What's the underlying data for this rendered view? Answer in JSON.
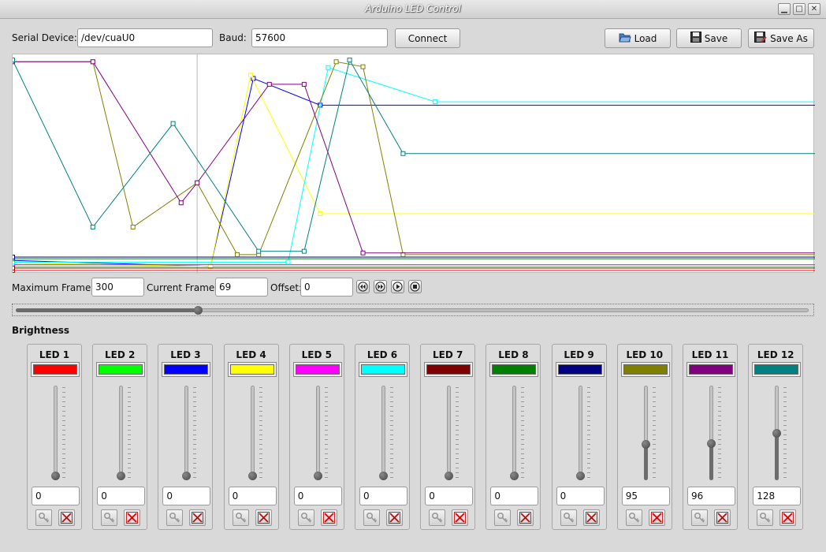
{
  "window": {
    "title": "Arduino LED Control"
  },
  "connection": {
    "serial_label": "Serial Device:",
    "serial_value": "/dev/cuaU0",
    "baud_label": "Baud:",
    "baud_value": "57600",
    "connect_label": "Connect"
  },
  "file": {
    "load_label": "Load",
    "save_label": "Save",
    "save_as_label": "Save As"
  },
  "frames": {
    "max_label": "Maximum Frame:",
    "max_value": "300",
    "current_label": "Current Frame:",
    "current_value": "69",
    "offset_label": "Offset:",
    "offset_value": "0",
    "position_fraction": 0.23
  },
  "brightness": {
    "title": "Brightness",
    "max": 255,
    "leds": [
      {
        "name": "LED 1",
        "value": "0",
        "color": "#ff0000"
      },
      {
        "name": "LED 2",
        "value": "0",
        "color": "#00ff00"
      },
      {
        "name": "LED 3",
        "value": "0",
        "color": "#0000ff"
      },
      {
        "name": "LED 4",
        "value": "0",
        "color": "#ffff00"
      },
      {
        "name": "LED 5",
        "value": "0",
        "color": "#ff00ff"
      },
      {
        "name": "LED 6",
        "value": "0",
        "color": "#00ffff"
      },
      {
        "name": "LED 7",
        "value": "0",
        "color": "#800000"
      },
      {
        "name": "LED 8",
        "value": "0",
        "color": "#008000"
      },
      {
        "name": "LED 9",
        "value": "0",
        "color": "#000080"
      },
      {
        "name": "LED 10",
        "value": "95",
        "color": "#808000"
      },
      {
        "name": "LED 11",
        "value": "96",
        "color": "#800080"
      },
      {
        "name": "LED 12",
        "value": "128",
        "color": "#008080"
      }
    ]
  },
  "chart_data": {
    "type": "line",
    "xlim": [
      0,
      300
    ],
    "ylim": [
      0,
      255
    ],
    "current_frame": 69,
    "series": [
      {
        "led": "LED 1",
        "color": "#ff0000",
        "points": [
          [
            0,
            0
          ],
          [
            300,
            0
          ]
        ]
      },
      {
        "led": "LED 2",
        "color": "#00ff00",
        "points": [
          [
            0,
            5
          ],
          [
            300,
            5
          ]
        ]
      },
      {
        "led": "LED 3",
        "color": "#0000ff",
        "points": [
          [
            0,
            12
          ],
          [
            74,
            5
          ],
          [
            90,
            230
          ],
          [
            115,
            198
          ],
          [
            300,
            198
          ]
        ]
      },
      {
        "led": "LED 4",
        "color": "#ffff00",
        "points": [
          [
            0,
            9
          ],
          [
            74,
            5
          ],
          [
            89,
            234
          ],
          [
            115,
            68
          ],
          [
            300,
            68
          ]
        ]
      },
      {
        "led": "LED 5",
        "color": "#ff00ff",
        "points": [
          [
            0,
            7
          ],
          [
            300,
            7
          ]
        ]
      },
      {
        "led": "LED 6",
        "color": "#00ffff",
        "points": [
          [
            0,
            10
          ],
          [
            103,
            10
          ],
          [
            118,
            243
          ],
          [
            158,
            202
          ],
          [
            300,
            202
          ]
        ]
      },
      {
        "led": "LED 7",
        "color": "#800000",
        "points": [
          [
            0,
            3
          ],
          [
            300,
            3
          ]
        ]
      },
      {
        "led": "LED 8",
        "color": "#008000",
        "points": [
          [
            0,
            14
          ],
          [
            300,
            14
          ]
        ]
      },
      {
        "led": "LED 9",
        "color": "#000080",
        "points": [
          [
            0,
            16
          ],
          [
            300,
            16
          ]
        ]
      },
      {
        "led": "LED 10",
        "color": "#808000",
        "points": [
          [
            0,
            250
          ],
          [
            30,
            250
          ],
          [
            45,
            52
          ],
          [
            69,
            105
          ],
          [
            84,
            19
          ],
          [
            92,
            19
          ],
          [
            121,
            250
          ],
          [
            131,
            244
          ],
          [
            146,
            19
          ],
          [
            300,
            19
          ]
        ]
      },
      {
        "led": "LED 11",
        "color": "#800080",
        "points": [
          [
            0,
            250
          ],
          [
            30,
            250
          ],
          [
            63,
            81
          ],
          [
            69,
            105
          ],
          [
            96,
            223
          ],
          [
            109,
            223
          ],
          [
            131,
            21
          ],
          [
            300,
            21
          ]
        ]
      },
      {
        "led": "LED 12",
        "color": "#008080",
        "points": [
          [
            0,
            252
          ],
          [
            30,
            52
          ],
          [
            60,
            176
          ],
          [
            92,
            23
          ],
          [
            109,
            23
          ],
          [
            126,
            252
          ],
          [
            146,
            140
          ],
          [
            300,
            140
          ]
        ]
      }
    ]
  }
}
